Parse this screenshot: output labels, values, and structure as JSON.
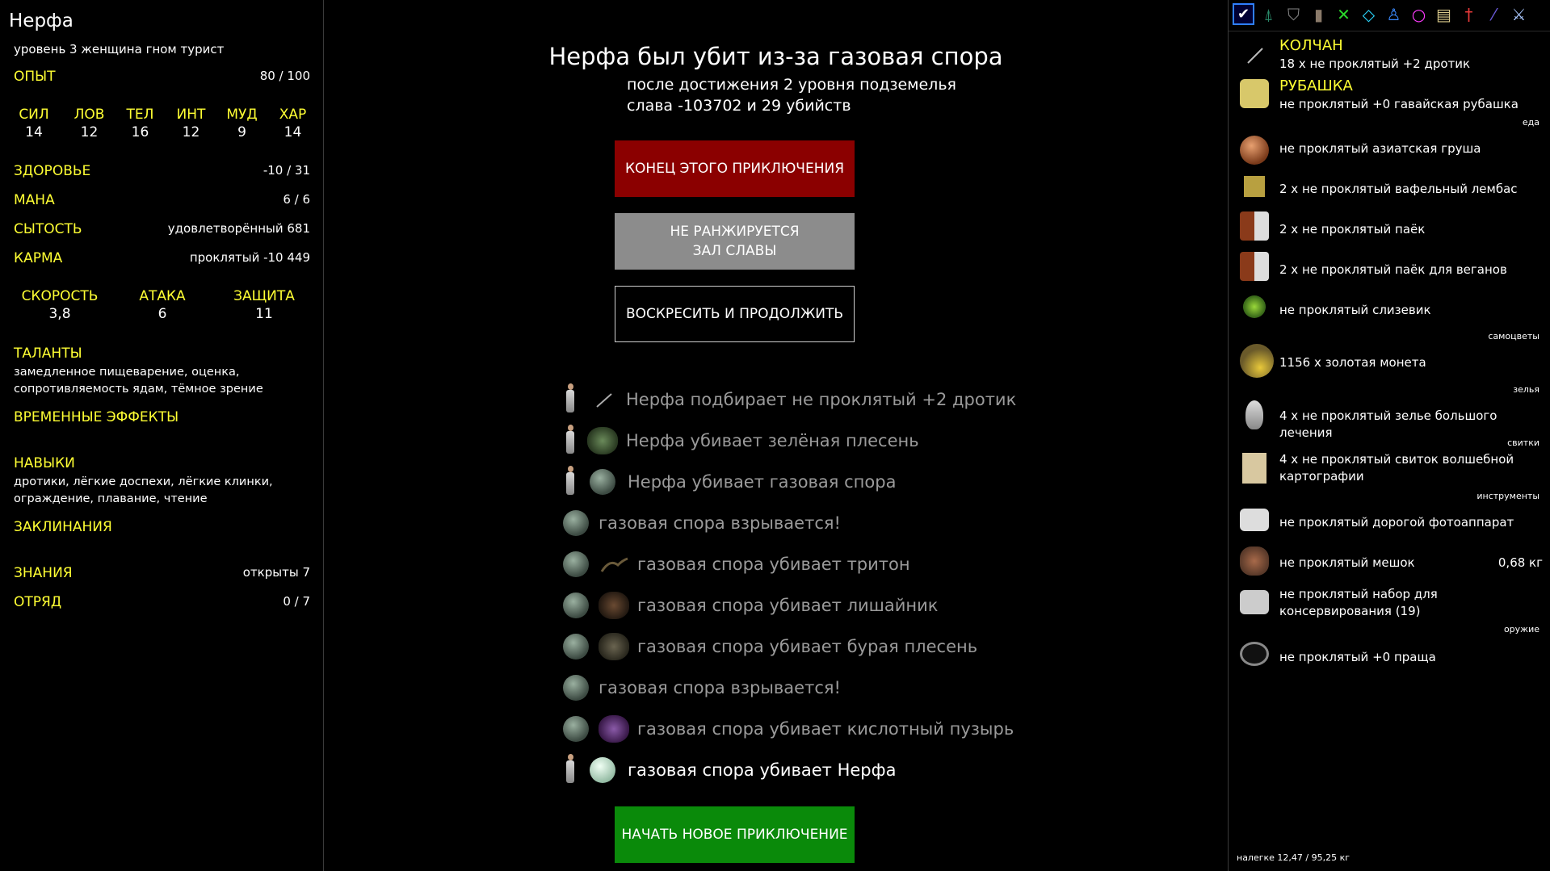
{
  "character": {
    "name": "Нерфа",
    "subtitle": "уровень 3 женщина гном турист",
    "exp_label": "ОПЫТ",
    "exp_value": "80 / 100",
    "stats": [
      {
        "label": "СИЛ",
        "value": "14"
      },
      {
        "label": "ЛОВ",
        "value": "12"
      },
      {
        "label": "ТЕЛ",
        "value": "16"
      },
      {
        "label": "ИНТ",
        "value": "12"
      },
      {
        "label": "МУД",
        "value": "9"
      },
      {
        "label": "ХАР",
        "value": "14"
      }
    ],
    "health_label": "ЗДОРОВЬЕ",
    "health_value": "-10 / 31",
    "mana_label": "МАНА",
    "mana_value": "6 / 6",
    "satiety_label": "СЫТОСТЬ",
    "satiety_value": "удовлетворённый 681",
    "karma_label": "КАРМА",
    "karma_value": "проклятый -10 449",
    "combat": [
      {
        "label": "СКОРОСТЬ",
        "value": "3,8"
      },
      {
        "label": "АТАКА",
        "value": "6"
      },
      {
        "label": "ЗАЩИТА",
        "value": "11"
      }
    ],
    "talents_label": "ТАЛАНТЫ",
    "talents": "замедленное пищеварение, оценка, сопротивляемость ядам, тёмное зрение",
    "effects_label": "ВРЕМЕННЫЕ ЭФФЕКТЫ",
    "skills_label": "НАВЫКИ",
    "skills": "дротики, лёгкие доспехи, лёгкие клинки, ограждение, плавание, чтение",
    "spells_label": "ЗАКЛИНАНИЯ",
    "knowledge_label": "ЗНАНИЯ",
    "knowledge_value": "открыты 7",
    "party_label": "ОТРЯД",
    "party_value": "0 / 7"
  },
  "death": {
    "title": "Нерфа был убит из-за газовая спора",
    "line1": "после достижения 2 уровня подземелья",
    "line2": "слава -103702 и 29 убийств",
    "btn_end": "КОНЕЦ ЭТОГО ПРИКЛЮЧЕНИЯ",
    "btn_rank_1": "НЕ РАНЖИРУЕТСЯ",
    "btn_rank_2": "ЗАЛ СЛАВЫ",
    "btn_resurrect": "ВОСКРЕСИТЬ И ПРОДОЛЖИТЬ",
    "btn_new": "НАЧАТЬ НОВОЕ ПРИКЛЮЧЕНИЕ"
  },
  "log": [
    {
      "text": "Нерфа подбирает не проклятый +2 дротик"
    },
    {
      "text": "Нерфа убивает зелёная плесень"
    },
    {
      "text": "Нерфа убивает газовая спора"
    },
    {
      "text": "газовая спора взрывается!"
    },
    {
      "text": "газовая спора убивает тритон"
    },
    {
      "text": "газовая спора убивает лишайник"
    },
    {
      "text": "газовая спора убивает бурая плесень"
    },
    {
      "text": "газовая спора взрывается!"
    },
    {
      "text": "газовая спора убивает кислотный пузырь"
    },
    {
      "text": "газовая спора убивает Нерфа"
    }
  ],
  "inventory": {
    "quiver_head": "КОЛЧАН",
    "quiver_item": "18 x не проклятый +2 дротик",
    "shirt_head": "РУБАШКА",
    "shirt_item": "не проклятый +0 гавайская рубашка",
    "cat_food": "еда",
    "food1": "не проклятый азиатская груша",
    "food2": "2 x не проклятый вафельный лембас",
    "food3": "2 x не проклятый паёк",
    "food4": "2 x не проклятый паёк для веганов",
    "food5": "не проклятый слизевик",
    "cat_gems": "самоцветы",
    "gold": "1156 x золотая монета",
    "cat_potions": "зелья",
    "potion": "4 x не проклятый зелье большого лечения",
    "cat_scrolls": "свитки",
    "scroll": "4 x не проклятый свиток волшебной картографии",
    "cat_tools": "инструменты",
    "tool1": "не проклятый дорогой фотоаппарат",
    "tool2": "не проклятый мешок",
    "tool2_weight": "0,68 кг",
    "tool3": "не проклятый набор для консервирования (19)",
    "cat_weapons": "оружие",
    "weapon": "не проклятый +0 праща",
    "burden": "налегке 12,47 / 95,25 кг"
  },
  "tabs": [
    "all-items",
    "missiles",
    "armor",
    "food",
    "weapons",
    "gems",
    "potions",
    "rings",
    "scrolls",
    "tools",
    "wands",
    "swords"
  ]
}
